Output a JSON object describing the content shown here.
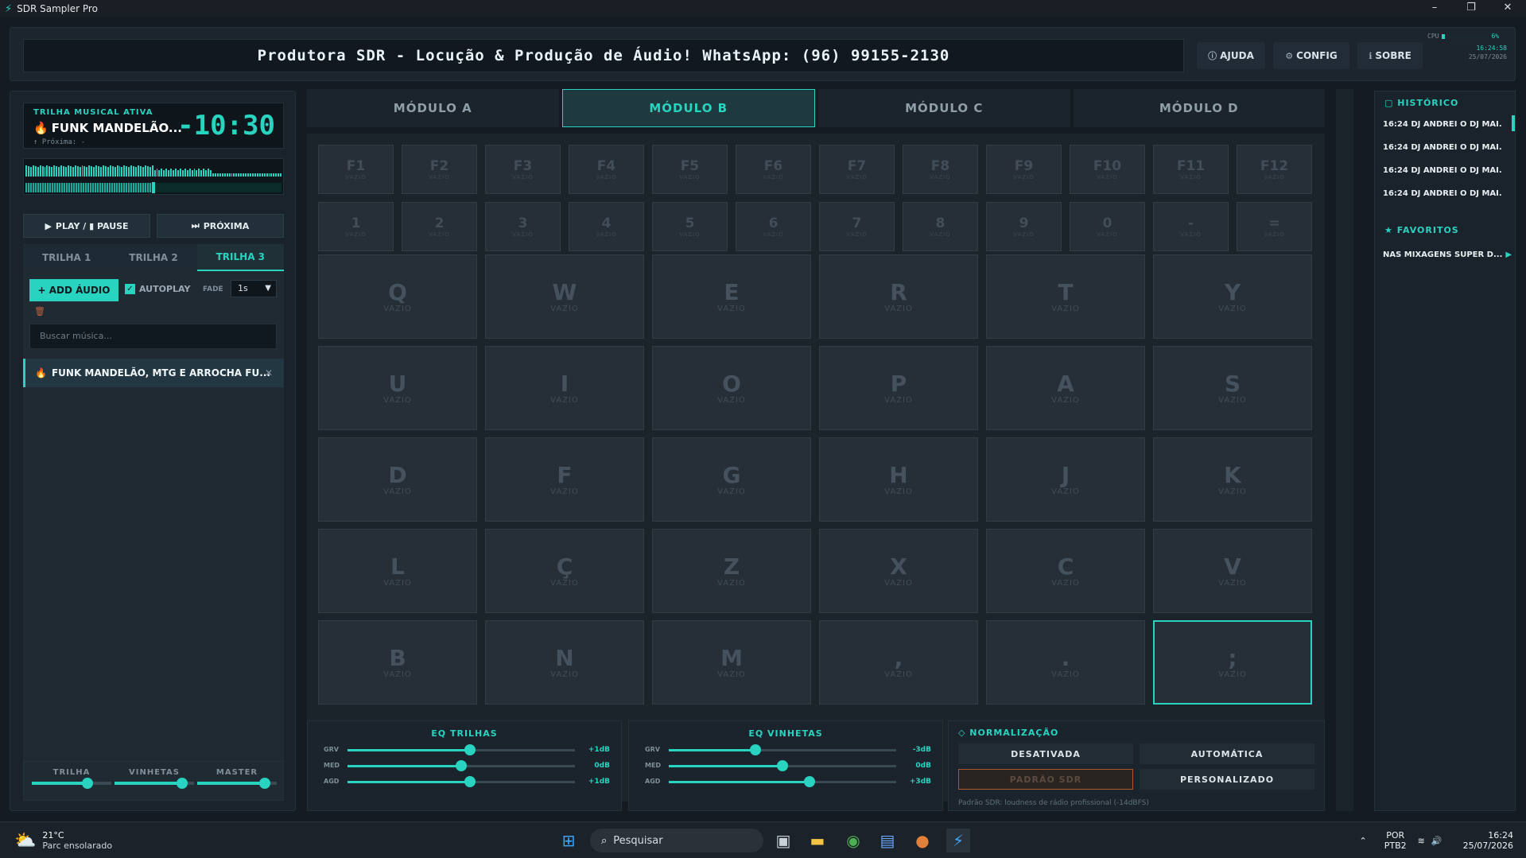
{
  "window": {
    "title": "SDR Sampler Pro"
  },
  "header": {
    "marquee": "Produtora SDR - Locução & Produção de Áudio! WhatsApp: (96) 99155-2130",
    "help_label": "AJUDA",
    "config_label": "CONFIG",
    "about_label": "SOBRE",
    "cpu_label": "CPU",
    "cpu_value": "6%",
    "clock": "16:24:58",
    "date": "25/07/2026"
  },
  "player": {
    "label": "TRILHA MUSICAL ATIVA",
    "title": "FUNK MANDELÃO...",
    "remaining": "-10:30",
    "next": "↑ Próxima: -",
    "progress": 0.5,
    "play_pause_label": "PLAY / ▮ PAUSE",
    "next_label": "PRÓXIMA"
  },
  "track_tabs": [
    "TRILHA 1",
    "TRILHA 2",
    "TRILHA 3"
  ],
  "active_track_tab": "TRILHA 3",
  "track_panel": {
    "add_label": "+ ADD ÁUDIO",
    "autoplay_label": "AUTOPLAY",
    "autoplay_checked": true,
    "fade_label": "FADE",
    "fade_value": "1s",
    "search_placeholder": "Buscar música...",
    "items": [
      "FUNK MANDELÃO, MTG E ARROCHA FU..."
    ]
  },
  "volumes": [
    {
      "label": "TRILHA",
      "level": 0.7
    },
    {
      "label": "VINHETAS",
      "level": 0.85
    },
    {
      "label": "MASTER",
      "level": 0.85
    }
  ],
  "modules": [
    "MÓDULO A",
    "MÓDULO B",
    "MÓDULO C",
    "MÓDULO D"
  ],
  "active_module": "MÓDULO B",
  "empty_label": "VAZIO",
  "fkeys": [
    "F1",
    "F2",
    "F3",
    "F4",
    "F5",
    "F6",
    "F7",
    "F8",
    "F9",
    "F10",
    "F11",
    "F12"
  ],
  "numkeys": [
    "1",
    "2",
    "3",
    "4",
    "5",
    "6",
    "7",
    "8",
    "9",
    "0",
    "-",
    "="
  ],
  "pads": [
    "Q",
    "W",
    "E",
    "R",
    "T",
    "Y",
    "U",
    "I",
    "O",
    "P",
    "A",
    "S",
    "D",
    "F",
    "G",
    "H",
    "J",
    "K",
    "L",
    "Ç",
    "Z",
    "X",
    "C",
    "V",
    "B",
    "N",
    "M",
    ",",
    ".",
    ";"
  ],
  "selected_pad": ";",
  "eq_tracks": {
    "title": "EQ TRILHAS",
    "bands": [
      {
        "label": "GRV",
        "value": "+1dB",
        "level": 0.54
      },
      {
        "label": "MED",
        "value": "0dB",
        "level": 0.5
      },
      {
        "label": "AGD",
        "value": "+1dB",
        "level": 0.54
      }
    ]
  },
  "eq_jingles": {
    "title": "EQ VINHETAS",
    "bands": [
      {
        "label": "GRV",
        "value": "-3dB",
        "level": 0.38
      },
      {
        "label": "MED",
        "value": "0dB",
        "level": 0.5
      },
      {
        "label": "AGD",
        "value": "+3dB",
        "level": 0.62
      }
    ]
  },
  "normalization": {
    "title": "NORMALIZAÇÃO",
    "off_label": "DESATIVADA",
    "auto_label": "AUTOMÁTICA",
    "sdr_label": "PADRÃO SDR",
    "custom_label": "PERSONALIZADO",
    "note": "Padrão SDR: loudness de rádio profissional (-14dBFS)"
  },
  "history": {
    "title": "HISTÓRICO",
    "items": [
      "16:24 DJ ANDREI O DJ MAI...",
      "16:24 DJ ANDREI O DJ MAI...",
      "16:24 DJ ANDREI O DJ MAI...",
      "16:24 DJ ANDREI O DJ MAI..."
    ]
  },
  "favorites": {
    "title": "FAVORITOS",
    "items": [
      "NAS MIXAGENS SUPER D..."
    ]
  },
  "taskbar": {
    "temp": "21°C",
    "weather": "Parc ensolarado",
    "search_placeholder": "Pesquisar",
    "lang1": "POR",
    "lang2": "PTB2",
    "time": "16:24",
    "date": "25/07/2026"
  },
  "colors": {
    "accent": "#28d3c0",
    "warning": "#b0552f",
    "background": "#141b22"
  }
}
